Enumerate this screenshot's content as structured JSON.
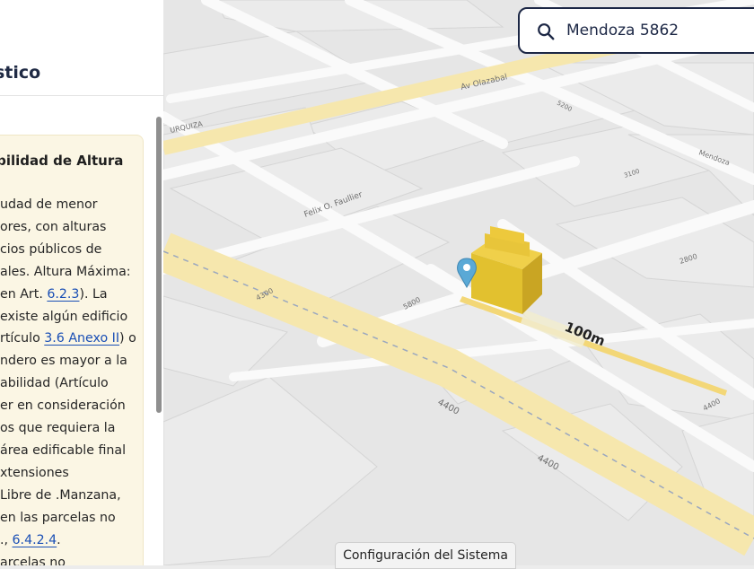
{
  "panel": {
    "title": "stico",
    "card": {
      "title": "abilidad de Altura",
      "lines": [
        {
          "text": "udad de menor"
        },
        {
          "text": "ores, con alturas"
        },
        {
          "text": "cios públicos de"
        },
        {
          "text": "ales. Altura Máxima:"
        },
        {
          "text": " en Art. ",
          "link": "6.2.3",
          "after": "). La"
        },
        {
          "text": "existe algún edificio"
        },
        {
          "text": "rtículo ",
          "link": "3.6 Anexo II",
          "after": ") o"
        },
        {
          "text": "ndero es mayor a la"
        },
        {
          "text": "abilidad (Artículo"
        },
        {
          "text": "er en consideración"
        },
        {
          "text": "os que requiera la"
        },
        {
          "text": "área edificable final"
        },
        {
          "text": "xtensiones"
        },
        {
          "text": "Libre de .Manzana,"
        },
        {
          "text": "en las parcelas no"
        },
        {
          "text": "., ",
          "link": "6.4.2.4",
          "after": "."
        },
        {
          "text": "arcelas no"
        }
      ]
    }
  },
  "search": {
    "value": "Mendoza 5862",
    "icon": "search-icon"
  },
  "footer": {
    "label": "Configuración del Sistema"
  },
  "map": {
    "street_labels": [
      {
        "text": "Av Olazabal"
      },
      {
        "text": "URQUIZA"
      },
      {
        "text": "Felix O. Faullier"
      },
      {
        "text": "Mendoza"
      },
      {
        "text": "5800"
      },
      {
        "text": "4300"
      },
      {
        "text": "4400"
      },
      {
        "text": "4400"
      },
      {
        "text": "4400"
      },
      {
        "text": "5800"
      },
      {
        "text": "5200"
      },
      {
        "text": "2800"
      },
      {
        "text": "3100"
      }
    ],
    "scale_label": "100m",
    "colors": {
      "avenue": "#f6e7ad",
      "street": "#ffffff",
      "block": "#e8e8e8",
      "building": "#e7c134",
      "pin": "#5aa9d6"
    }
  }
}
